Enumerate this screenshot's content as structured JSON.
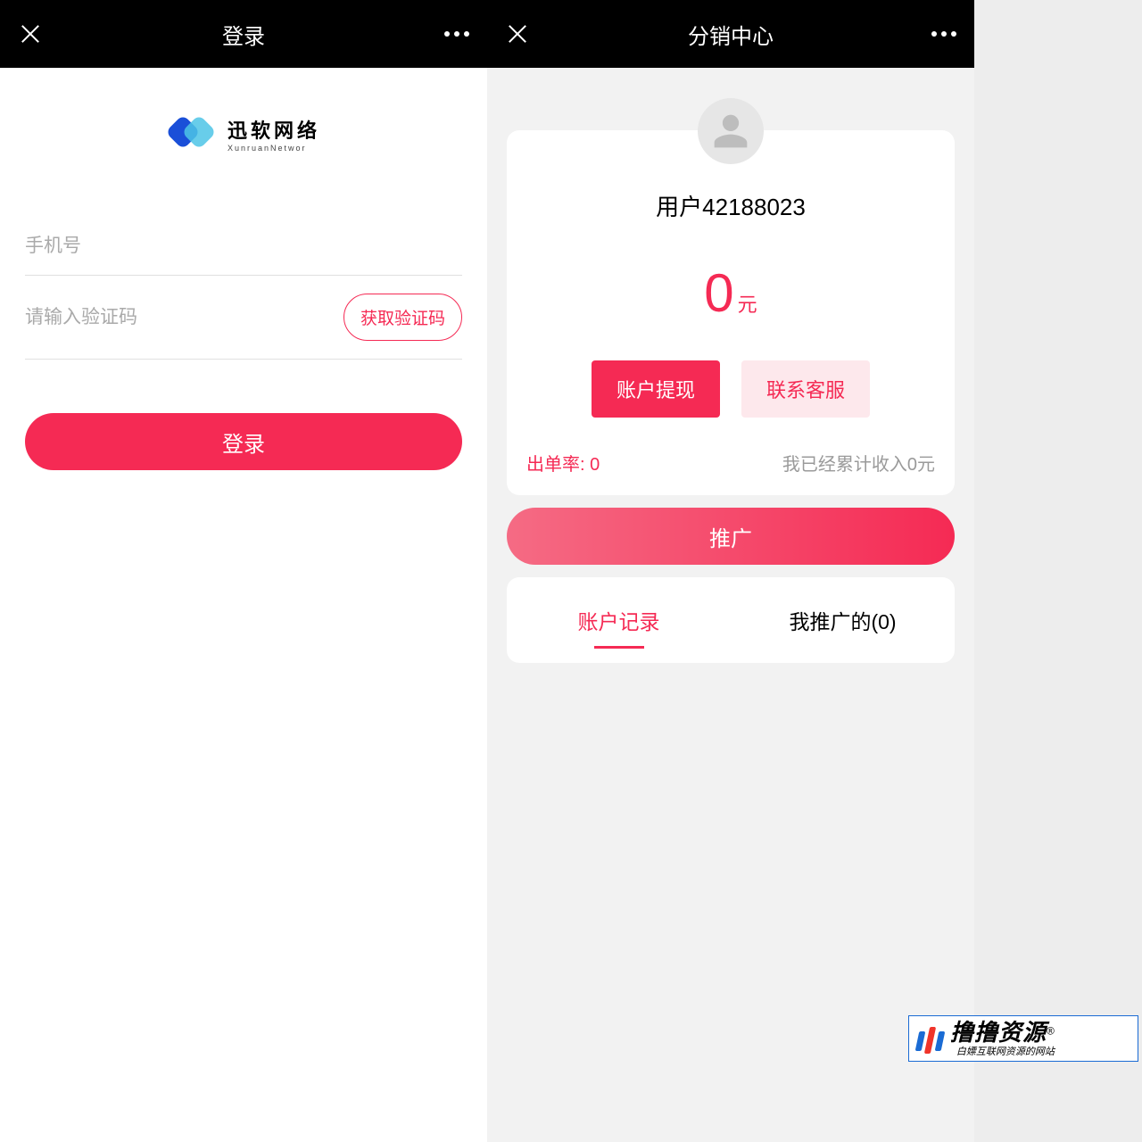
{
  "left": {
    "header": {
      "title": "登录"
    },
    "logo": {
      "cn": "迅软网络",
      "en": "XunruanNetwor"
    },
    "form": {
      "phone_placeholder": "手机号",
      "code_placeholder": "请输入验证码",
      "get_code_label": "获取验证码",
      "login_label": "登录"
    }
  },
  "right": {
    "header": {
      "title": "分销中心"
    },
    "user": {
      "name": "用户42188023"
    },
    "balance": {
      "amount": "0",
      "unit": "元"
    },
    "buttons": {
      "withdraw": "账户提现",
      "contact": "联系客服"
    },
    "stats": {
      "rate": "出单率: 0",
      "income": "我已经累计收入0元"
    },
    "promo": "推广",
    "tabs": {
      "records": "账户记录",
      "referrals": "我推广的(0)"
    }
  },
  "watermark": {
    "main": "撸撸资源",
    "sub": "白嫖互联网资源的网站",
    "reg": "®"
  }
}
